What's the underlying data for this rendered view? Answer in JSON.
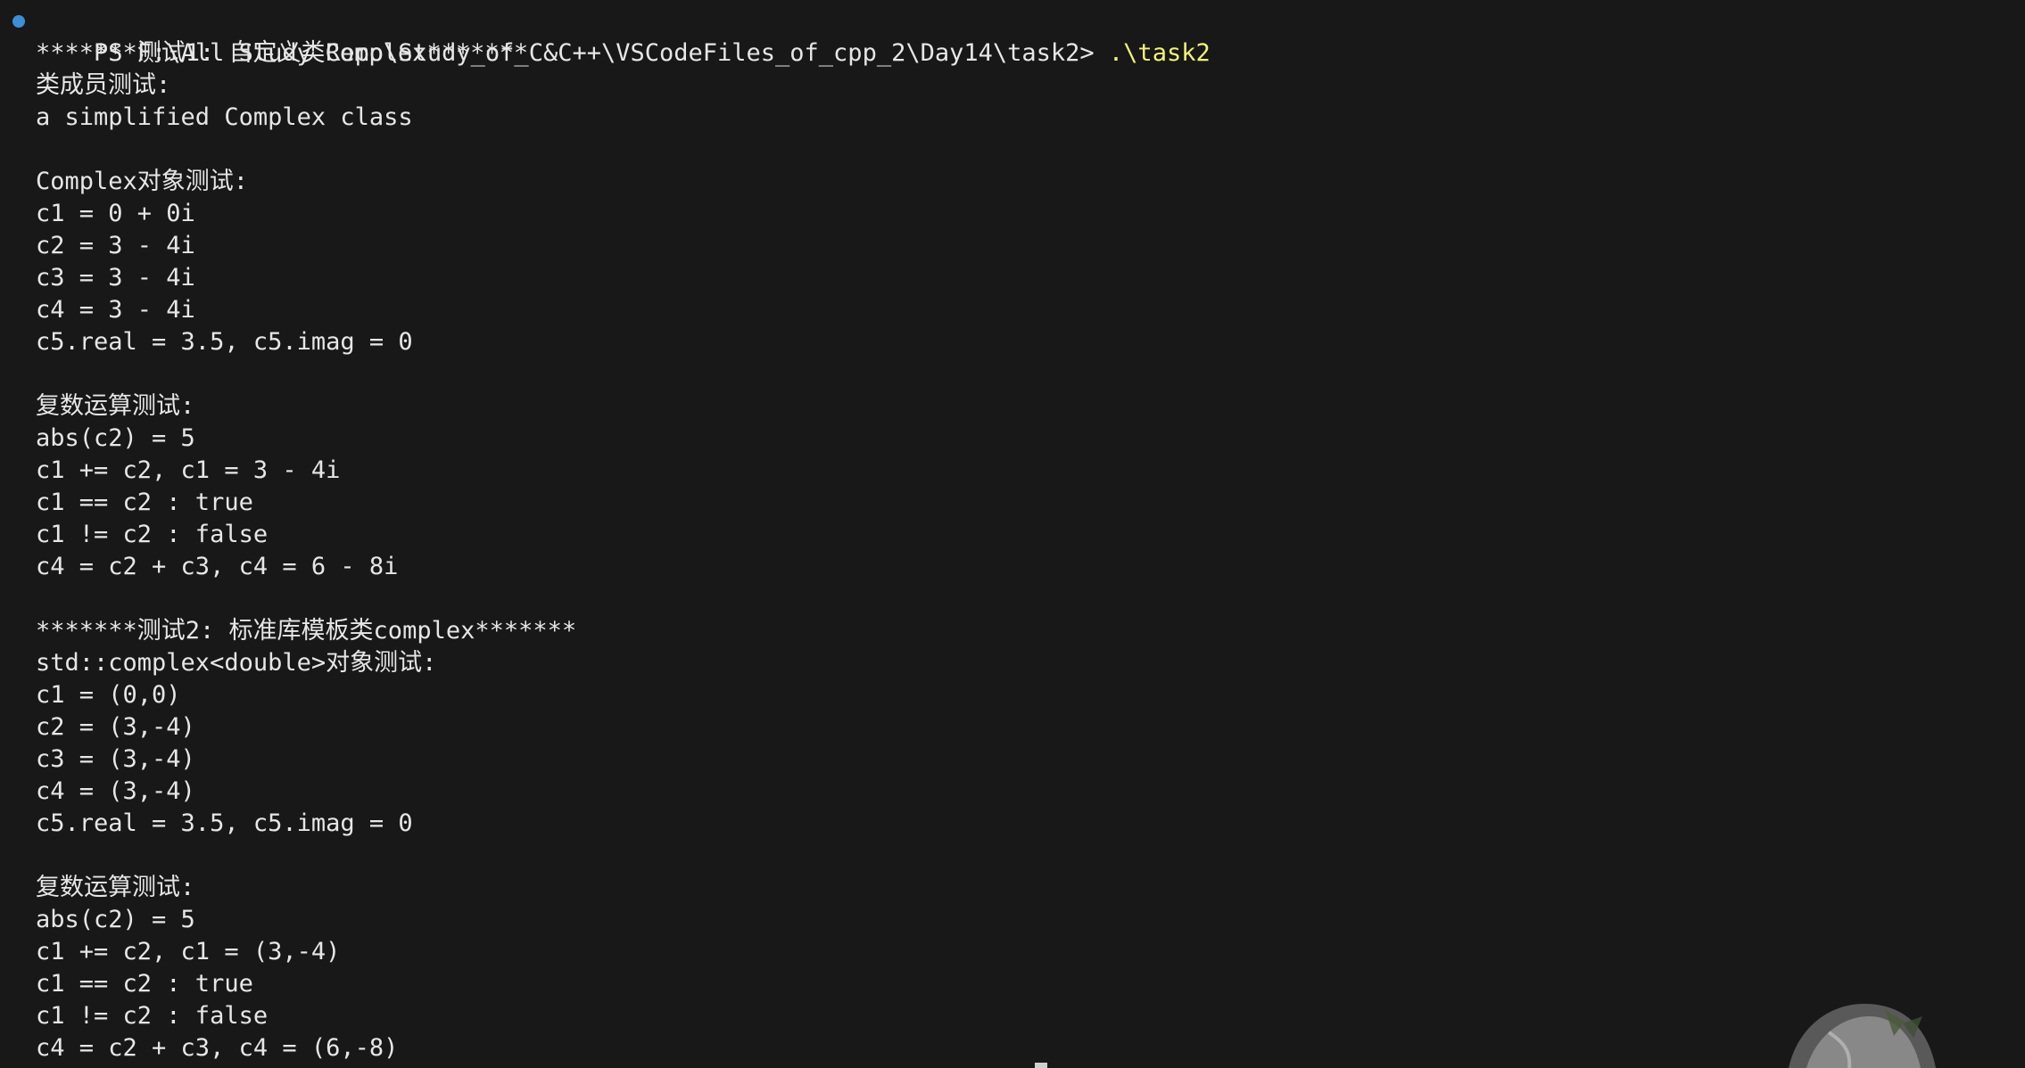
{
  "terminal": {
    "prompt": "PS F:\\All Study Repo\\Study_of_C&C++\\VSCodeFiles_of_cpp_2\\Day14\\task2>",
    "command": ".\\task2",
    "status_color": "#3c8ed6",
    "command_color": "#f2f27a",
    "output_lines": [
      "*******测试1: 自定义类Complex*******",
      "类成员测试:",
      "a simplified Complex class",
      "",
      "Complex对象测试:",
      "c1 = 0 + 0i",
      "c2 = 3 - 4i",
      "c3 = 3 - 4i",
      "c4 = 3 - 4i",
      "c5.real = 3.5, c5.imag = 0",
      "",
      "复数运算测试:",
      "abs(c2) = 5",
      "c1 += c2, c1 = 3 - 4i",
      "c1 == c2 : true",
      "c1 != c2 : false",
      "c4 = c2 + c3, c4 = 6 - 8i",
      "",
      "*******测试2: 标准库模板类complex*******",
      "std::complex<double>对象测试:",
      "c1 = (0,0)",
      "c2 = (3,-4)",
      "c3 = (3,-4)",
      "c4 = (3,-4)",
      "c5.real = 3.5, c5.imag = 0",
      "",
      "复数运算测试:",
      "abs(c2) = 5",
      "c1 += c2, c1 = (3,-4)",
      "c1 == c2 : true",
      "c1 != c2 : false",
      "c4 = c2 + c3, c4 = (6,-8)"
    ]
  }
}
